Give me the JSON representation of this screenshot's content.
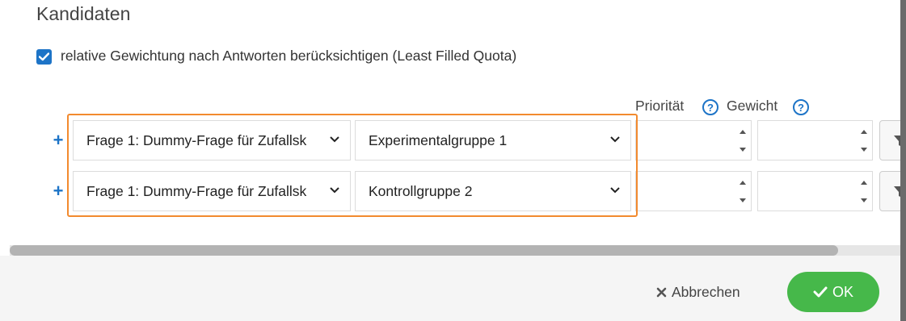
{
  "dialog": {
    "title": "Kandidaten",
    "checkbox": {
      "label": "relative Gewichtung nach Antworten berücksichtigen (Least Filled Quota)",
      "checked": true
    },
    "columns": {
      "priority": "Priorität",
      "weight": "Gewicht",
      "help_glyph": "?"
    },
    "rows": [
      {
        "question": "Frage 1: Dummy-Frage für Zufallsk",
        "group": "Experimentalgruppe 1",
        "priority": "",
        "weight": ""
      },
      {
        "question": "Frage 1: Dummy-Frage für Zufallsk",
        "group": "Kontrollgruppe 2",
        "priority": "",
        "weight": ""
      }
    ],
    "add_glyph": "+",
    "footer": {
      "cancel_label": "Abbrechen",
      "ok_label": "OK"
    },
    "scroll_position": 0.93
  },
  "colors": {
    "accent": "#1d74c7",
    "highlight": "#f28a2e",
    "ok": "#46b84a"
  },
  "icons": [
    "checkmark-icon",
    "help-icon",
    "plus-icon",
    "chevron-down-icon",
    "spin-up-icon",
    "spin-down-icon",
    "filter-icon",
    "close-icon"
  ]
}
